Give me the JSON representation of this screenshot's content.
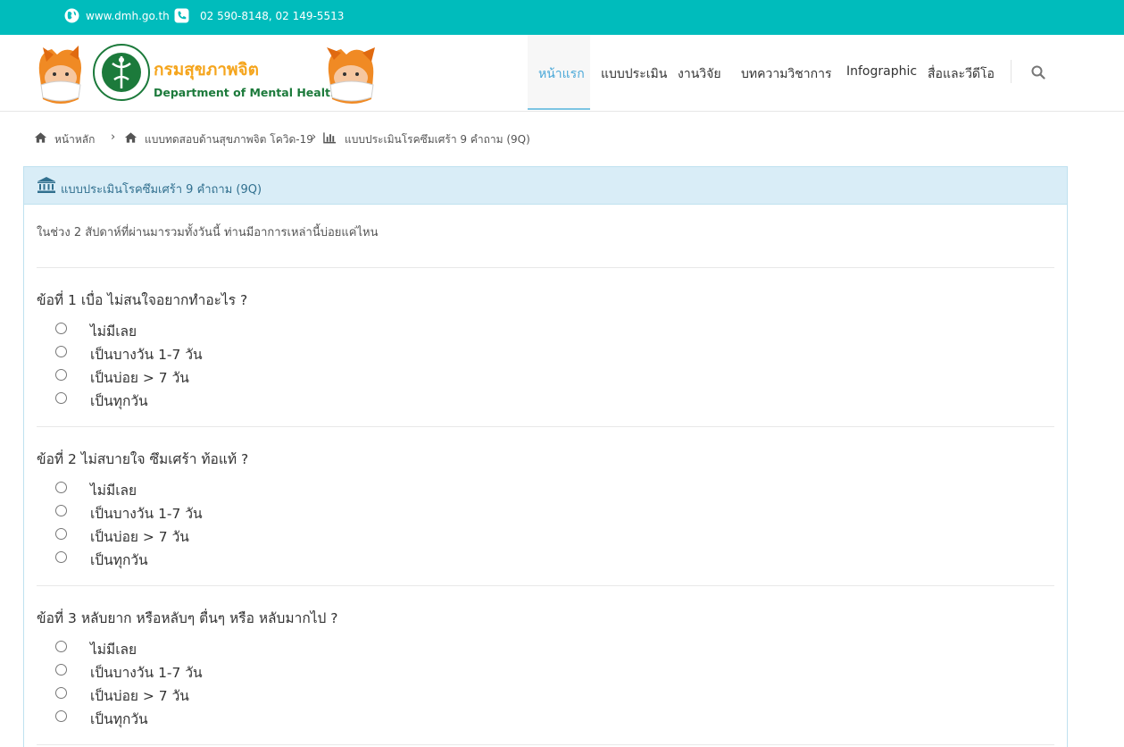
{
  "topbar": {
    "website": "www.dmh.go.th",
    "phone": "02 590-8148, 02 149-5513",
    "globe_icon": "globe-icon",
    "phone_icon": "phone-icon"
  },
  "brand": {
    "name_th": "กรมสุขภาพจิต",
    "name_en": "Department of Mental Health"
  },
  "nav": {
    "items": [
      "หน้าแรก",
      "แบบประเมิน",
      "งานวิจัย",
      "บทความวิชาการ",
      "Infographic",
      "สื่อและวีดีโอ"
    ],
    "active_index": 0,
    "search_icon": "search-icon"
  },
  "breadcrumb": {
    "items": [
      "หน้าหลัก",
      "แบบทดสอบด้านสุขภาพจิต โควิด-19",
      "แบบประเมินโรคซึมเศร้า 9 คำถาม (9Q)"
    ]
  },
  "panel": {
    "title": "แบบประเมินโรคซึมเศร้า 9 คำถาม (9Q)",
    "intro": "ในช่วง 2 สัปดาห์ที่ผ่านมารวมทั้งวันนี้ ท่านมีอาการเหล่านี้บ่อยแค่ไหน"
  },
  "questions": [
    {
      "title": "ข้อที่ 1 เบื่อ ไม่สนใจอยากทำอะไร ?",
      "options": [
        "ไม่มีเลย",
        "เป็นบางวัน 1-7 วัน",
        "เป็นบ่อย > 7 วัน",
        "เป็นทุกวัน"
      ]
    },
    {
      "title": "ข้อที่ 2 ไม่สบายใจ ซึมเศร้า ท้อแท้ ?",
      "options": [
        "ไม่มีเลย",
        "เป็นบางวัน 1-7 วัน",
        "เป็นบ่อย > 7 วัน",
        "เป็นทุกวัน"
      ]
    },
    {
      "title": "ข้อที่ 3 หลับยาก หรือหลับๆ ตื่นๆ หรือ หลับมากไป ?",
      "options": [
        "ไม่มีเลย",
        "เป็นบางวัน 1-7 วัน",
        "เป็นบ่อย > 7 วัน",
        "เป็นทุกวัน"
      ]
    }
  ],
  "colors": {
    "topbar": "#00bcbc",
    "brand_th": "#f5a51d",
    "brand_en": "#1c7a3b",
    "nav_active": "#4aa8d8",
    "panel_head": "#d9edf7",
    "panel_title": "#31708f"
  }
}
